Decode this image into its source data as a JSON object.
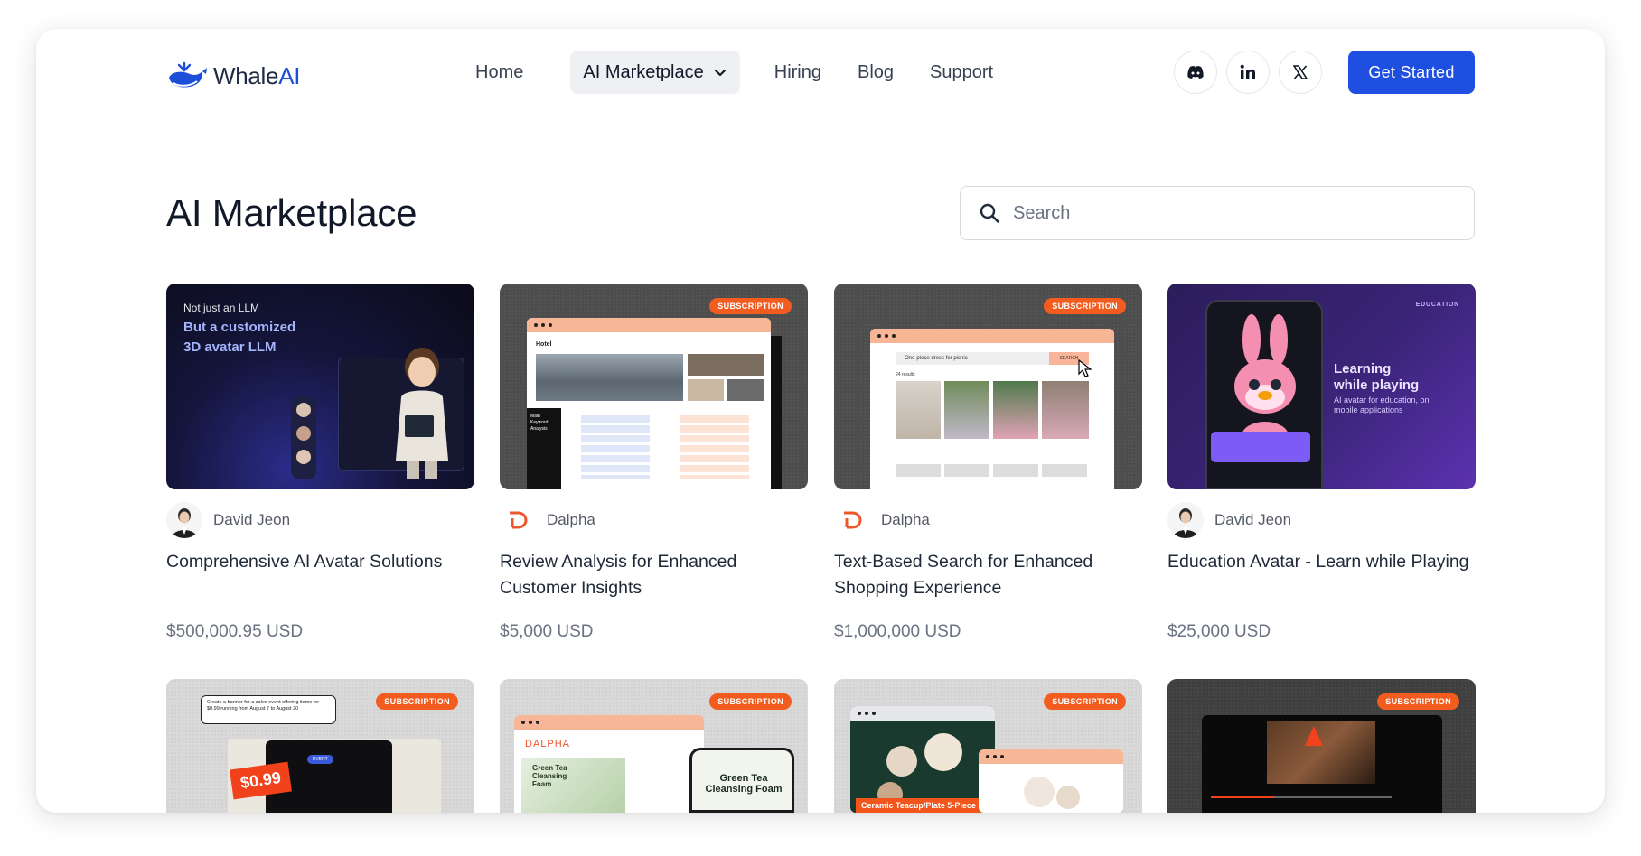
{
  "brand": {
    "name_part1": "Whale",
    "name_part2": "AI"
  },
  "nav": {
    "items": [
      {
        "label": "Home"
      },
      {
        "label": "AI Marketplace"
      },
      {
        "label": "Hiring"
      },
      {
        "label": "Blog"
      },
      {
        "label": "Support"
      }
    ],
    "socials": [
      "discord-icon",
      "linkedin-icon",
      "x-icon"
    ],
    "cta_label": "Get Started"
  },
  "page": {
    "title": "AI Marketplace",
    "search_placeholder": "Search"
  },
  "products": [
    {
      "author": "David Jeon",
      "title": "Comprehensive AI Avatar Solutions",
      "price": "$500,000.95 USD",
      "thumb": {
        "line1": "Not just an LLM",
        "line2": "But a customized",
        "line3": "3D avatar LLM"
      }
    },
    {
      "author": "Dalpha",
      "title": "Review Analysis for Enhanced Customer Insights",
      "price": "$5,000 USD",
      "thumb": {
        "badge": "SUBSCRIPTION",
        "tab": "Hotel",
        "side": "Main Keyword Analysis"
      }
    },
    {
      "author": "Dalpha",
      "title": "Text-Based Search for Enhanced Shopping Experience",
      "price": "$1,000,000 USD",
      "thumb": {
        "badge": "SUBSCRIPTION",
        "query": "One-piece dress for picnic",
        "button": "SEARCH",
        "results": "24 results"
      }
    },
    {
      "author": "David Jeon",
      "title": "Education Avatar -  Learn while Playing",
      "price": "$25,000 USD",
      "thumb": {
        "tag": "EDUCATION",
        "line1": "Learning",
        "line2": "while playing",
        "sub": "AI avatar for education, on mobile applications"
      }
    }
  ],
  "row2": [
    {
      "badge": "SUBSCRIPTION",
      "bubble": "Create a banner for a sales event offering items for $0.99 running from August 7 to August 20",
      "price_tag": "$0.99",
      "event": "EVENT"
    },
    {
      "badge": "SUBSCRIPTION",
      "logo": "DALPHA",
      "product1": "Green Tea Cleansing Foam",
      "product2": "Green Tea Cleansing Foam"
    },
    {
      "badge": "SUBSCRIPTION",
      "caption": "Ceramic Teacup/Plate 5-Piece S"
    },
    {
      "badge": "SUBSCRIPTION"
    }
  ],
  "colors": {
    "accent": "#1f4fe0",
    "subscription": "#f25c1f",
    "dalpha": "#f0562b"
  }
}
